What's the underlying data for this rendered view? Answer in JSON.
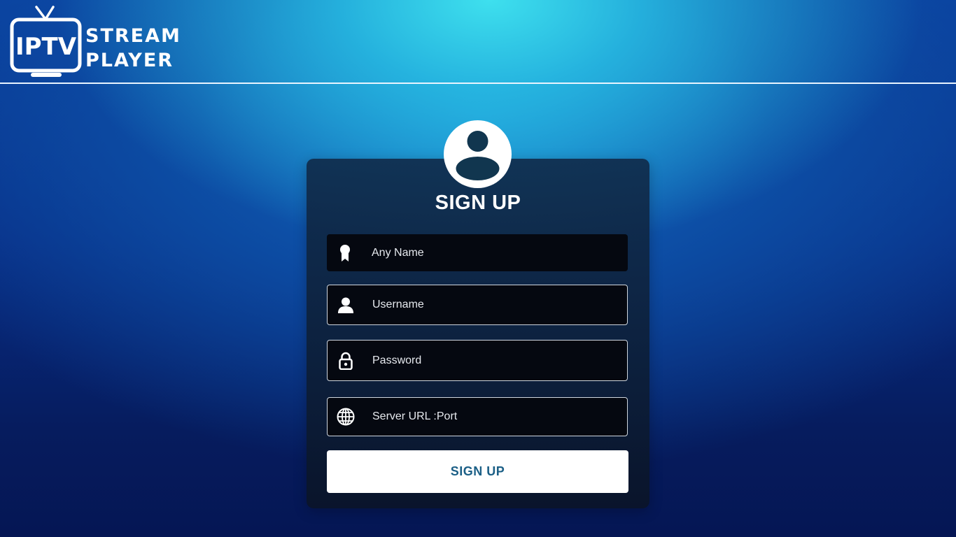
{
  "app": {
    "logo_badge": "IPTV",
    "logo_line1": "STREAM",
    "logo_line2": "PLAYER"
  },
  "form": {
    "title": "SIGN UP",
    "fields": [
      {
        "icon": "ribbon-icon",
        "placeholder": "Any Name",
        "value": ""
      },
      {
        "icon": "user-icon",
        "placeholder": "Username",
        "value": ""
      },
      {
        "icon": "lock-icon",
        "placeholder": "Password",
        "value": ""
      },
      {
        "icon": "globe-icon",
        "placeholder": "Server URL :Port",
        "value": ""
      }
    ],
    "submit_label": "SIGN UP"
  },
  "colors": {
    "background_top": "#3ee0ee",
    "background_bottom": "#051654",
    "card": "#0f2a47",
    "field": "#050810",
    "button": "#ffffff",
    "button_text": "#1b5f86"
  }
}
